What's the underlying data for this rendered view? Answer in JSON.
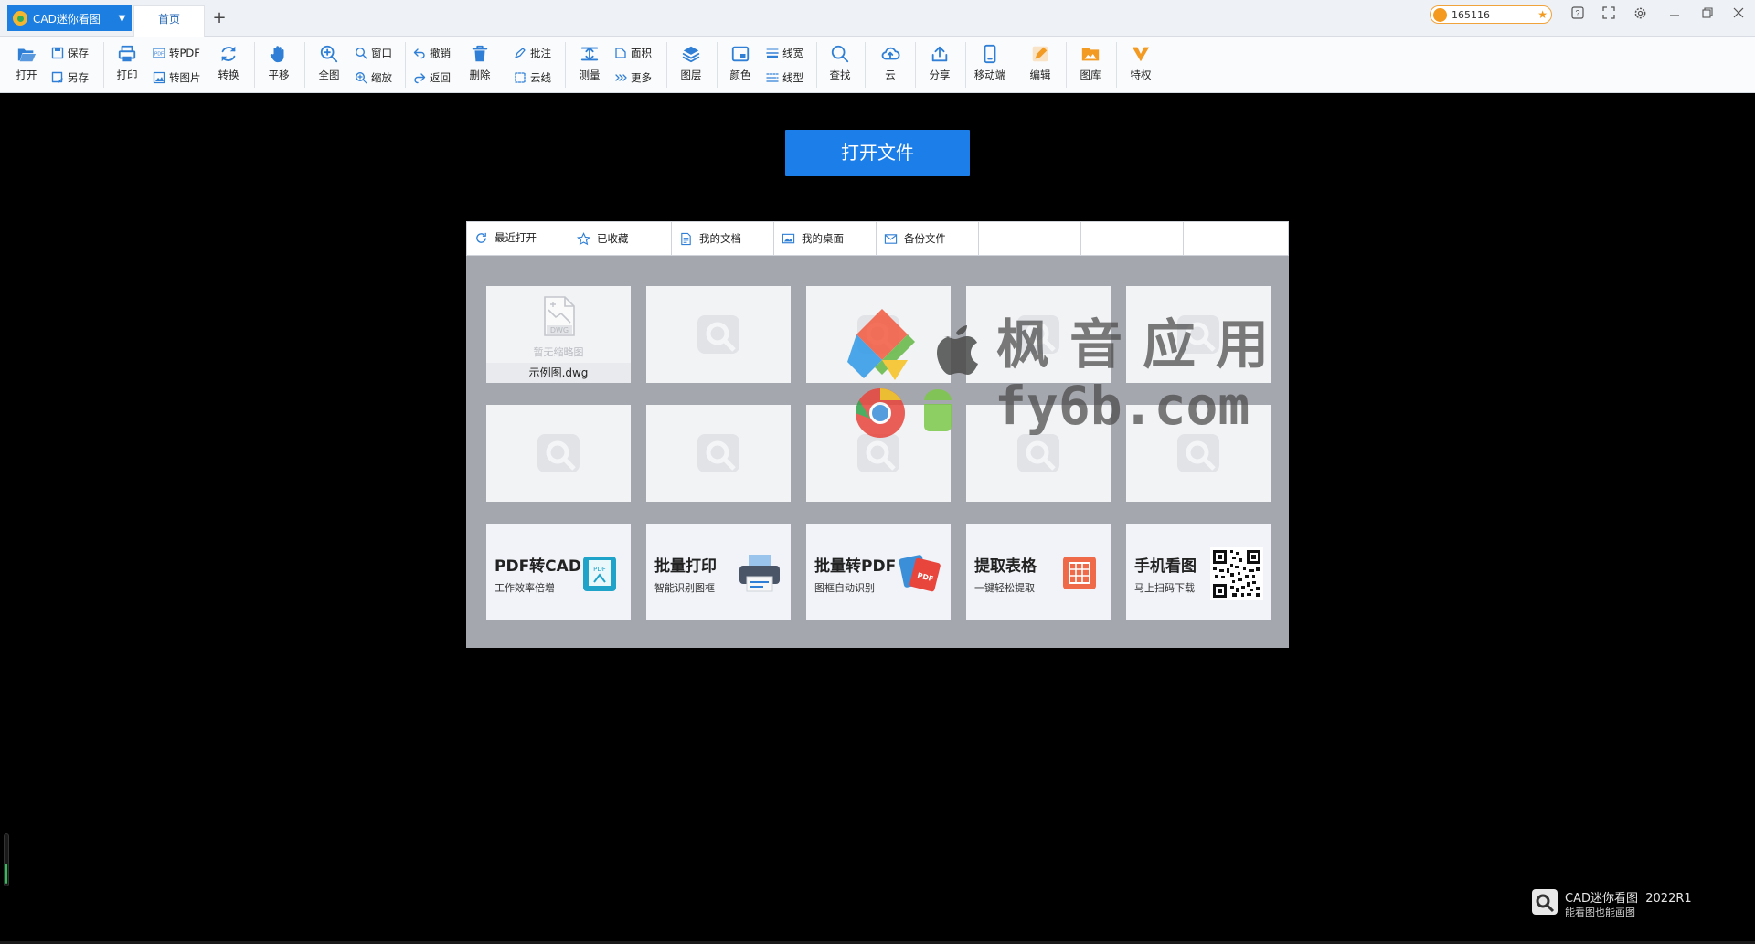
{
  "titlebar": {
    "app_name": "CAD迷你看图",
    "home_tab": "首页",
    "new_tab": "+",
    "user_id": "165116"
  },
  "toolbar": {
    "open": "打开",
    "save": "保存",
    "save_as": "另存",
    "print": "打印",
    "to_pdf": "转PDF",
    "to_image": "转图片",
    "convert": "转换",
    "pan": "平移",
    "full_view": "全图",
    "window": "窗口",
    "zoom": "缩放",
    "undo": "撤销",
    "back": "返回",
    "delete": "删除",
    "annotate": "批注",
    "cloud_line": "云线",
    "measure": "测量",
    "area": "面积",
    "more": "更多",
    "layers": "图层",
    "color": "颜色",
    "line_width": "线宽",
    "line_type": "线型",
    "find": "查找",
    "cloud": "云",
    "share": "分享",
    "mobile": "移动端",
    "edit": "编辑",
    "gallery": "图库",
    "privilege": "特权"
  },
  "main": {
    "open_file": "打开文件",
    "tabs": [
      "最近打开",
      "已收藏",
      "我的文档",
      "我的桌面",
      "备份文件"
    ],
    "recent_file": {
      "name": "示例图.dwg",
      "no_thumb": "暂无缩略图",
      "badge": "DWG"
    },
    "promos": [
      {
        "title": "PDF转CAD",
        "subtitle": "工作效率倍增"
      },
      {
        "title": "批量打印",
        "subtitle": "智能识别图框"
      },
      {
        "title": "批量转PDF",
        "subtitle": "图框自动识别"
      },
      {
        "title": "提取表格",
        "subtitle": "一键轻松提取"
      },
      {
        "title": "手机看图",
        "subtitle": "马上扫码下载"
      }
    ]
  },
  "watermark": {
    "text": "枫音应用",
    "url": "fy6b.com"
  },
  "brand": {
    "name": "CAD迷你看图",
    "version": "2022R1",
    "slogan": "能看图也能画图"
  },
  "colors": {
    "accent": "#1c7ee8",
    "toolbar_icon": "#2f7fd6",
    "canvas": "#000000",
    "panel": "#a5a7ae"
  }
}
